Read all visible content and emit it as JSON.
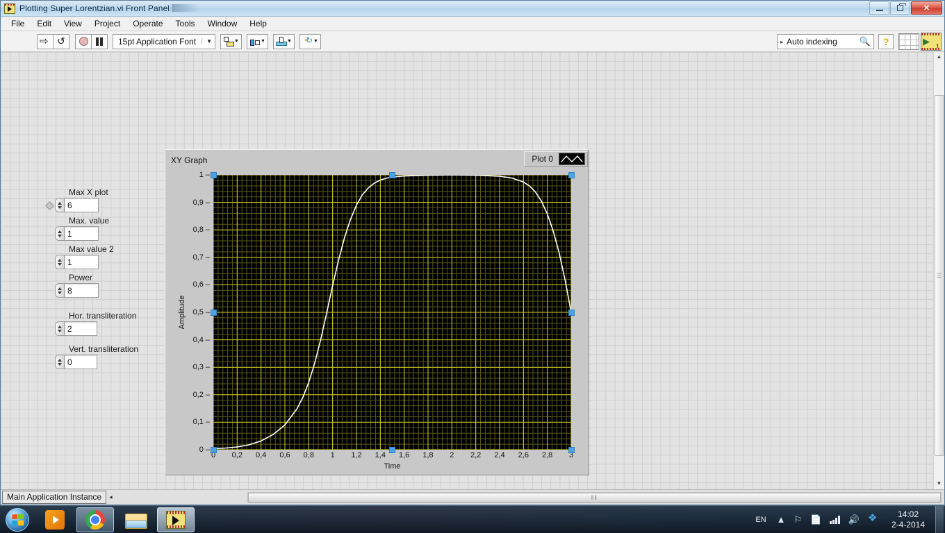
{
  "window": {
    "title": "Plotting Super Lorentzian.vi Front Panel",
    "icon": "labview-vi-icon",
    "buttons": {
      "minimize": "minimize-button",
      "restore": "restore-button",
      "close": "✕"
    }
  },
  "menu": {
    "items": [
      "File",
      "Edit",
      "View",
      "Project",
      "Operate",
      "Tools",
      "Window",
      "Help"
    ]
  },
  "toolbar": {
    "run": "run-arrow-icon",
    "run_continuously": "run-continuously-icon",
    "abort": "abort-execution-icon",
    "pause": "pause-icon",
    "font_selector": "15pt Application Font",
    "font_caret": "▼",
    "align_objects": "align-objects-icon",
    "distribute_objects": "distribute-objects-icon",
    "reorder": "reorder-objects-icon",
    "resize_objects": "resize-objects-icon",
    "caret": "▼",
    "search_value": "Auto indexing",
    "search_arrow": "▸",
    "search_icon": "magnifier-icon",
    "help_label": "?",
    "panel_grid": "panel-grid-icon",
    "vi_thumb_number": "1"
  },
  "controls": [
    {
      "label": "Max X plot",
      "value": "6",
      "name": "max-x-plot"
    },
    {
      "label": "Max. value",
      "value": "1",
      "name": "max-value"
    },
    {
      "label": "Max value 2",
      "value": "1",
      "name": "max-value-2"
    },
    {
      "label": "Power",
      "value": "8",
      "name": "power"
    },
    {
      "label": "Hor. transliteration",
      "value": "2",
      "name": "hor-transliteration"
    },
    {
      "label": "Vert. transliteration",
      "value": "0",
      "name": "vert-transliteration"
    }
  ],
  "graph": {
    "title": "XY Graph",
    "legend_label": "Plot 0",
    "legend_swatch": "plot-line-sample-icon"
  },
  "statusbar": {
    "app_instance": "Main Application Instance",
    "arrow": "◂",
    "scroll_grip": "‖‖"
  },
  "taskbar": {
    "start": "windows-start-orb",
    "tasks": [
      {
        "name": "windows-media-player",
        "icon": "media-player-icon"
      },
      {
        "name": "google-chrome",
        "icon": "chrome-icon"
      },
      {
        "name": "windows-explorer",
        "icon": "folder-icon"
      },
      {
        "name": "labview",
        "icon": "labview-icon"
      }
    ],
    "tray": {
      "language": "EN",
      "show_hidden": "▲",
      "network_flag": "⚐",
      "action_center": "action-center-icon",
      "signal": "signal-bars-icon",
      "volume": "◂))",
      "dropbox": "dropbox-icon",
      "time": "14:02",
      "date": "2-4-2014"
    }
  },
  "colors": {
    "plot_line": "#ffffff",
    "plot_background": "#000000",
    "grid_major": "#cfcf2a",
    "grid_minor": "#5a5a12",
    "selection_handle": "#4aa3e8",
    "panel_background": "#e3e3e3",
    "titlebar_accent": "#b4d3ec"
  },
  "chart_data": {
    "type": "line",
    "title": "XY Graph",
    "xlabel": "Time",
    "ylabel": "Amplitude",
    "xlim": [
      0,
      3
    ],
    "ylim": [
      0,
      1
    ],
    "grid": true,
    "legend_position": "top-right",
    "xticks": [
      "0",
      "0,2",
      "0,4",
      "0,6",
      "0,8",
      "1",
      "1,2",
      "1,4",
      "1,6",
      "1,8",
      "2",
      "2,2",
      "2,4",
      "2,6",
      "2,8",
      "3"
    ],
    "xtick_values": [
      0,
      0.2,
      0.4,
      0.6,
      0.8,
      1,
      1.2,
      1.4,
      1.6,
      1.8,
      2,
      2.2,
      2.4,
      2.6,
      2.8,
      3
    ],
    "yticks": [
      "0",
      "0,1",
      "0,2",
      "0,3",
      "0,4",
      "0,5",
      "0,6",
      "0,7",
      "0,8",
      "0,9",
      "1"
    ],
    "ytick_values": [
      0,
      0.1,
      0.2,
      0.3,
      0.4,
      0.5,
      0.6,
      0.7,
      0.8,
      0.9,
      1
    ],
    "series": [
      {
        "name": "Plot 0",
        "color": "#ffffff",
        "x": [
          0,
          0.1,
          0.2,
          0.3,
          0.4,
          0.5,
          0.6,
          0.7,
          0.75,
          0.8,
          0.85,
          0.9,
          0.95,
          1.0,
          1.05,
          1.1,
          1.15,
          1.2,
          1.25,
          1.3,
          1.35,
          1.4,
          1.45,
          1.5,
          1.6,
          1.8,
          2.0,
          2.2,
          2.4,
          2.5,
          2.6,
          2.65,
          2.7,
          2.75,
          2.8,
          2.85,
          2.9,
          2.95,
          3.0
        ],
        "y": [
          0.004,
          0.006,
          0.01,
          0.018,
          0.032,
          0.055,
          0.09,
          0.148,
          0.19,
          0.245,
          0.315,
          0.4,
          0.497,
          0.597,
          0.69,
          0.772,
          0.838,
          0.89,
          0.928,
          0.953,
          0.97,
          0.981,
          0.988,
          0.992,
          0.996,
          0.999,
          1.0,
          0.999,
          0.995,
          0.989,
          0.974,
          0.96,
          0.938,
          0.905,
          0.858,
          0.795,
          0.715,
          0.615,
          0.5
        ]
      }
    ],
    "selection_handles": [
      {
        "x": 0,
        "y": 1
      },
      {
        "x": 1.5,
        "y": 1
      },
      {
        "x": 3,
        "y": 1
      },
      {
        "x": 0,
        "y": 0.5
      },
      {
        "x": 3,
        "y": 0.5
      },
      {
        "x": 0,
        "y": 0
      },
      {
        "x": 1.5,
        "y": 0
      },
      {
        "x": 3,
        "y": 0
      }
    ]
  }
}
